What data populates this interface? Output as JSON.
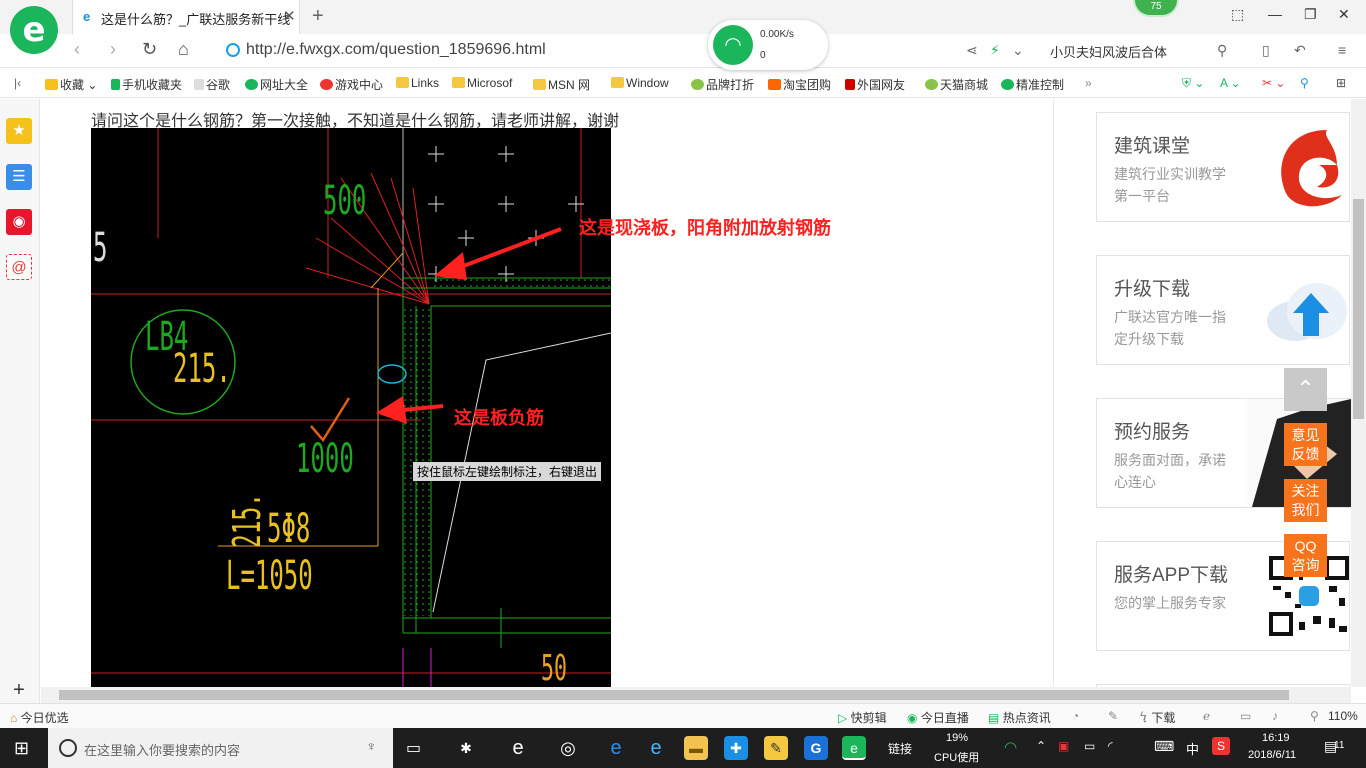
{
  "browser": {
    "tab_title": "这是什么筋？_广联达服务新干线",
    "url": "http://e.fwxgx.com/question_1859696.html",
    "badge": "75",
    "wifi": {
      "speed": "0.00K/s",
      "count": "0"
    },
    "search_text": "小贝夫妇风波后合体",
    "zoom": "110%"
  },
  "bookmarks": [
    "收藏",
    "手机收藏夹",
    "谷歌",
    "网址大全",
    "游戏中心",
    "Links",
    "Microsof",
    "MSN 网",
    "Window",
    "品牌打折",
    "淘宝团购",
    "外国网友",
    "天猫商城",
    "精准控制"
  ],
  "page": {
    "question": "请问这个是什么钢筋？第一次接触，不知道是什么钢筋，请老师讲解，谢谢"
  },
  "cad": {
    "annotation_1": "这是现浇板，阳角附加放射钢筋",
    "annotation_2": "这是板负筋",
    "tooltip": "按住鼠标左键绘制标注，右键退出",
    "label_500": "500",
    "label_5": "5",
    "label_lb": "LB4",
    "label_215a": "215.",
    "label_215b": "215.",
    "label_1000": "1000",
    "label_215c": "215",
    "label_spec": "5Φ8",
    "label_len": "L=1050",
    "label_bottom": "50"
  },
  "sidebar_cards": [
    {
      "title": "建筑课堂",
      "desc": "建筑行业实训教学第一平台"
    },
    {
      "title": "升级下载",
      "desc": "广联达官方唯一指定升级下载"
    },
    {
      "title": "预约服务",
      "desc": "服务面对面，承诺心连心"
    },
    {
      "title": "服务APP下载",
      "desc": "您的掌上服务专家"
    }
  ],
  "float_buttons": {
    "feedback": "意见反馈",
    "follow": "关注我们",
    "qq": "QQ咨询"
  },
  "statusbar": {
    "left": "今日优选",
    "items": [
      "快剪辑",
      "今日直播",
      "热点资讯",
      "下载"
    ]
  },
  "taskbar": {
    "search_placeholder": "在这里输入你要搜索的内容",
    "link_label": "链接",
    "cpu_percent": "19%",
    "cpu_label": "CPU使用",
    "ime": "中",
    "time": "16:19",
    "date": "2018/6/11",
    "notification_count": "11"
  },
  "colors": {
    "brand_green": "#1bb55c",
    "accent_orange": "#f7741c",
    "annotation_red": "#ff2020"
  }
}
